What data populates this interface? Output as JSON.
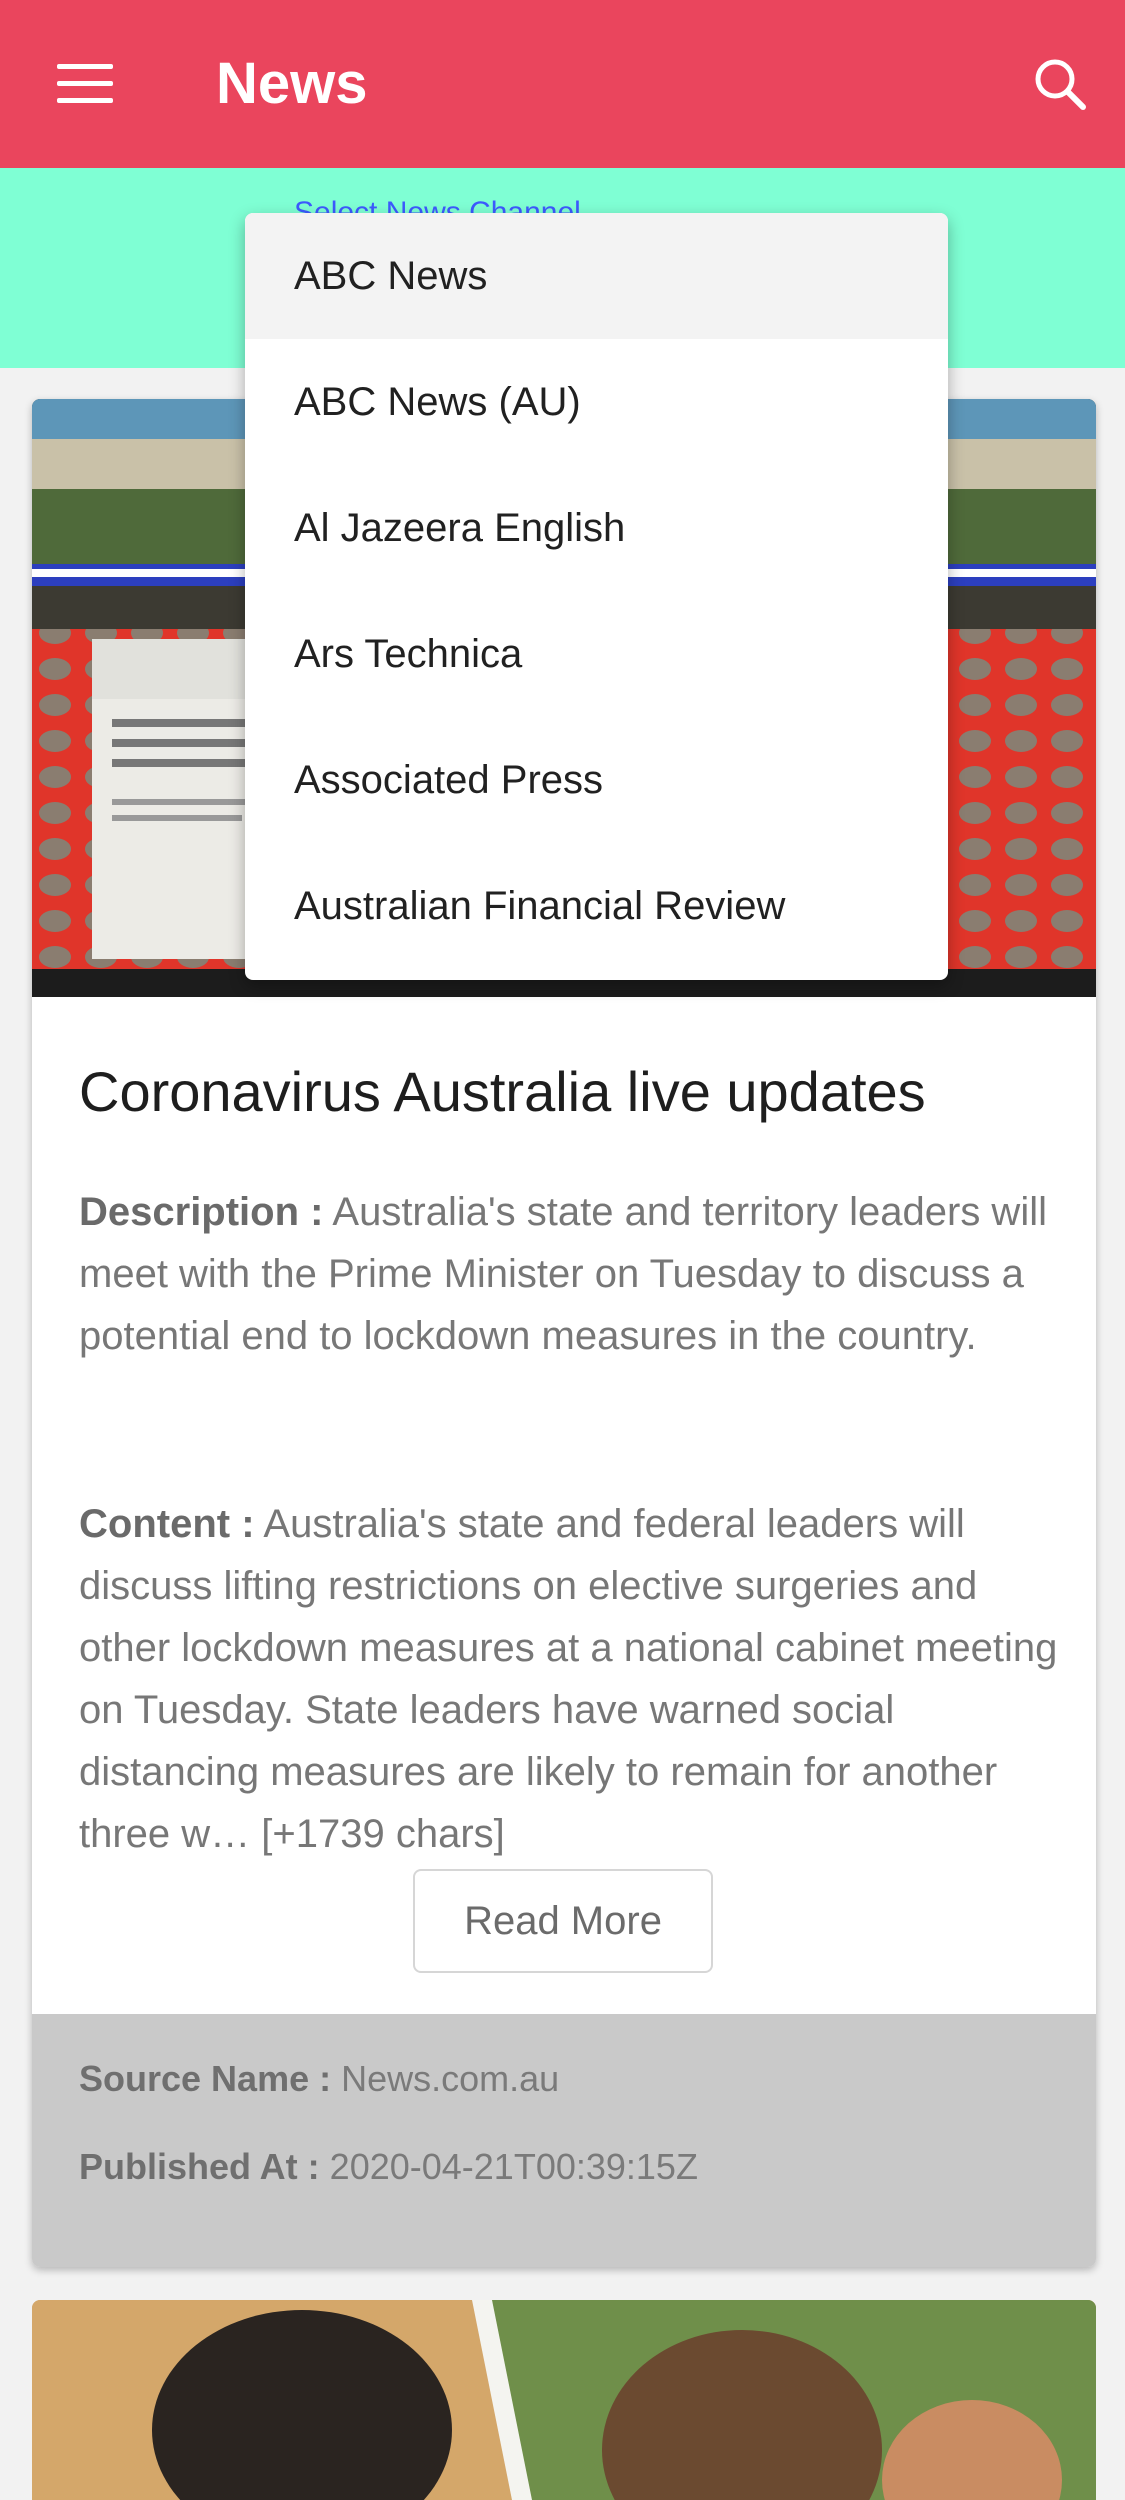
{
  "appbar": {
    "title": "News",
    "menu_icon": "hamburger-menu-icon",
    "search_icon": "search-icon",
    "color": "#ea455d"
  },
  "channel_selector": {
    "label": "Select News Channel",
    "background": "#7fffd4",
    "options": [
      "ABC News",
      "ABC News (AU)",
      "Al Jazeera English",
      "Ars Technica",
      "Associated Press",
      "Australian Financial Review"
    ],
    "highlighted": "ABC News"
  },
  "article": {
    "title": "Coronavirus Australia live updates",
    "description_label": "Description :",
    "description": " Australia's state and territory leaders will meet with the Prime Minister on Tuesday to discuss a potential end to lockdown measures in the country.",
    "content_label": "Content :",
    "content": " Australia's state and federal leaders will discuss lifting restrictions on elective surgeries and other lockdown measures at a national cabinet meeting on Tuesday. State leaders have warned social distancing measures are likely to remain for another three w… [+1739 chars]",
    "read_more_label": "Read More",
    "source_label": "Source Name :",
    "source_value": " News.com.au",
    "published_label": "Published At :",
    "published_value": " 2020-04-21T00:39:15Z"
  }
}
